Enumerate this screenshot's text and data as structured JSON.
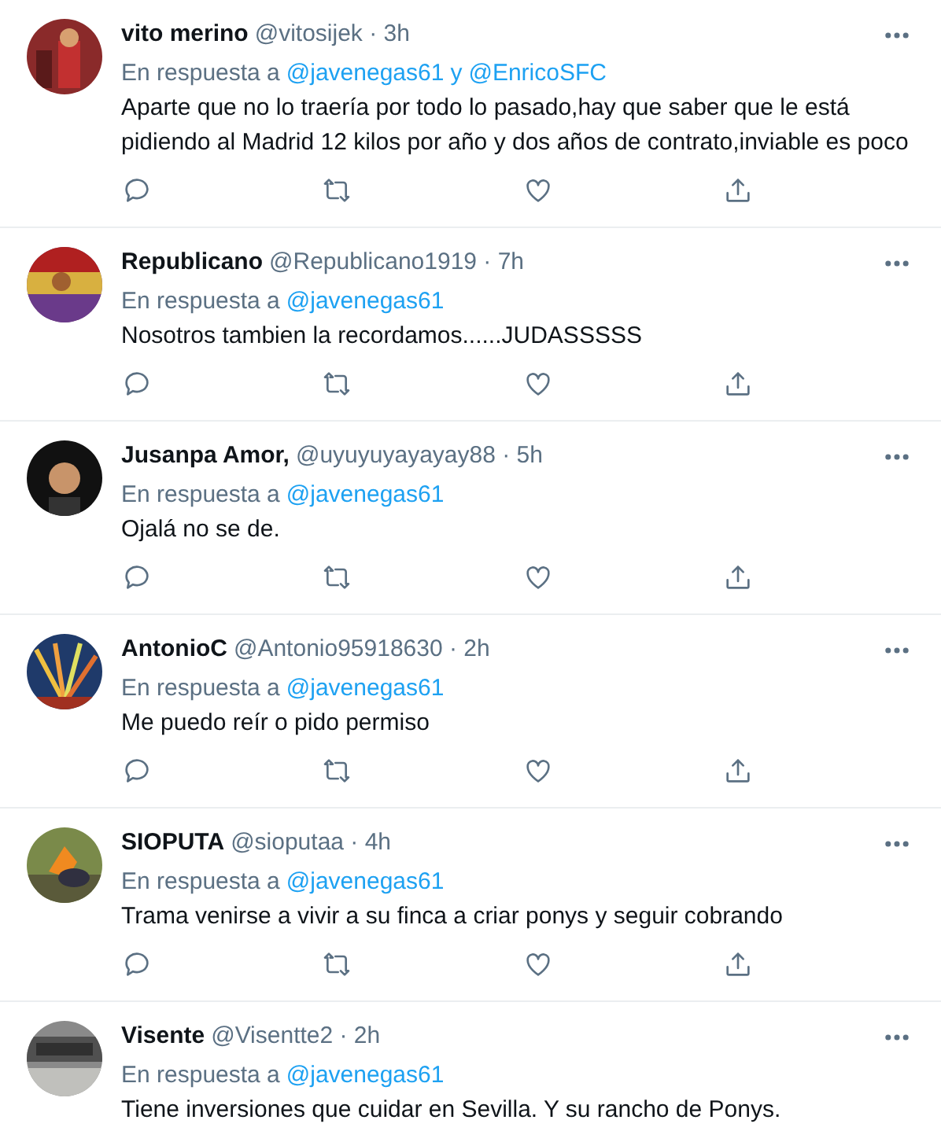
{
  "tweets": [
    {
      "name": "vito merino",
      "meta": "@vitosijek · 3h",
      "reply_label": "En respuesta a",
      "mentions": [
        "@javenegas61",
        "@EnricoSFC"
      ],
      "mention_joiner": "y",
      "text": "Aparte que no lo traería por todo lo pasado,hay que saber que le está pidiendo al Madrid 12 kilos por año y dos años de contrato,inviable es poco",
      "avatar": {
        "kind": "picture"
      },
      "actions": true
    },
    {
      "name": "Republicano",
      "meta": "@Republicano1919 · 7h",
      "reply_label": "En respuesta a",
      "mentions": [
        "@javenegas61"
      ],
      "text": "Nosotros tambien la recordamos......JUDASSSSS",
      "avatar": {
        "kind": "picture"
      },
      "actions": true
    },
    {
      "name": "Jusanpa Amor,",
      "meta": "@uyuyuyayayay88 · 5h",
      "reply_label": "En respuesta a",
      "mentions": [
        "@javenegas61"
      ],
      "text": "Ojalá no se de.",
      "avatar": {
        "kind": "picture"
      },
      "actions": true
    },
    {
      "name": "AntonioC",
      "meta": "@Antonio95918630 · 2h",
      "reply_label": "En respuesta a",
      "mentions": [
        "@javenegas61"
      ],
      "text": "Me puedo reír o pido permiso",
      "avatar": {
        "kind": "picture"
      },
      "actions": true
    },
    {
      "name": "SIOPUTA",
      "meta": "@sioputaa · 4h",
      "reply_label": "En respuesta a",
      "mentions": [
        "@javenegas61"
      ],
      "text": "Trama venirse a vivir a su finca a criar ponys y seguir cobrando",
      "avatar": {
        "kind": "picture"
      },
      "actions": true
    },
    {
      "name": "Visente",
      "meta": "@Visentte2 · 2h",
      "reply_label": "En respuesta a",
      "mentions": [
        "@javenegas61"
      ],
      "text": "Tiene inversiones que cuidar en Sevilla. Y su rancho de Ponys.",
      "avatar": {
        "kind": "picture"
      },
      "actions": false
    }
  ]
}
